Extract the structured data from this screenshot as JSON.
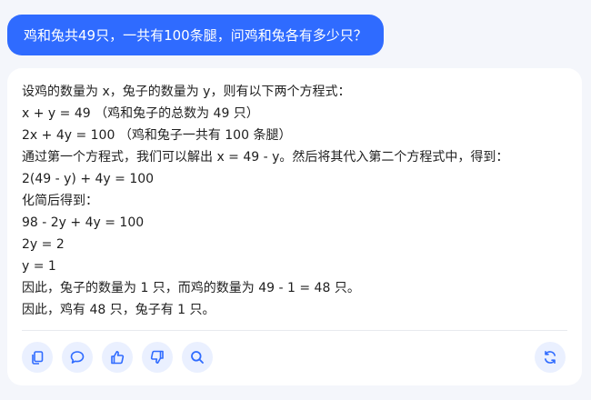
{
  "question": {
    "text": "鸡和兔共49只，一共有100条腿，问鸡和兔各有多少只？"
  },
  "answer": {
    "lines": [
      "设鸡的数量为 x，兔子的数量为 y，则有以下两个方程式：",
      "x + y = 49 （鸡和兔子的总数为 49 只）",
      "2x + 4y = 100 （鸡和兔子一共有 100 条腿）",
      "通过第一个方程式，我们可以解出 x = 49 - y。然后将其代入第二个方程式中，得到：",
      "2(49 - y) + 4y = 100",
      "化简后得到：",
      "98 - 2y + 4y = 100",
      "2y = 2",
      "y = 1",
      "因此，兔子的数量为 1 只，而鸡的数量为 49 - 1 = 48 只。",
      "因此，鸡有 48 只，兔子有 1 只。"
    ]
  },
  "actions": {
    "copy": "copy-icon",
    "comment": "chat-bubble-icon",
    "like": "thumbs-up-icon",
    "dislike": "thumbs-down-icon",
    "search": "search-icon",
    "regenerate": "refresh-icon"
  },
  "colors": {
    "accent": "#2f6bff",
    "background": "#f4f6fb",
    "card": "#ffffff",
    "button_bg": "#eaf0ff",
    "text": "#1f1f1f"
  }
}
